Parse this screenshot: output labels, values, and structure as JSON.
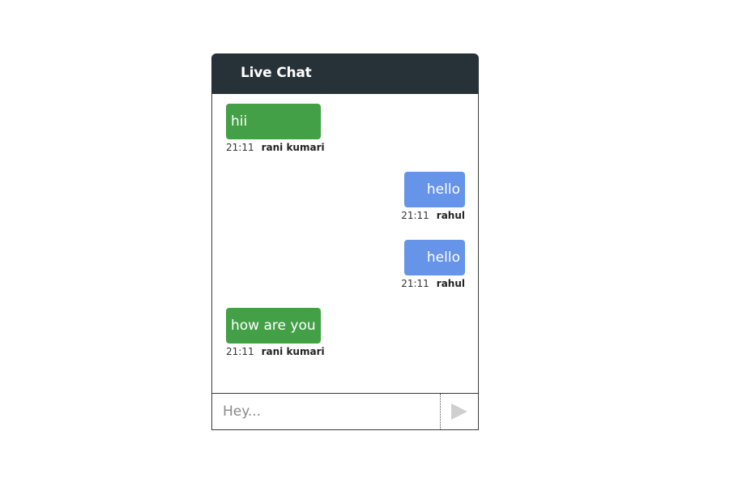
{
  "chat": {
    "title": "Live Chat",
    "messages": [
      {
        "text": "hii",
        "time": "21:11",
        "sender": "rani kumari",
        "direction": "received"
      },
      {
        "text": "hello",
        "time": "21:11",
        "sender": "rahul",
        "direction": "sent"
      },
      {
        "text": "hello",
        "time": "21:11",
        "sender": "rahul",
        "direction": "sent"
      },
      {
        "text": "how are you",
        "time": "21:11",
        "sender": "rani kumari",
        "direction": "received"
      }
    ]
  },
  "composer": {
    "placeholder": "Hey...",
    "value": "",
    "send_icon": "send-icon"
  },
  "colors": {
    "header_background": "#263238",
    "received_bubble": "#43a047",
    "sent_bubble": "#6694e8",
    "send_icon": "#cfcfcf"
  }
}
